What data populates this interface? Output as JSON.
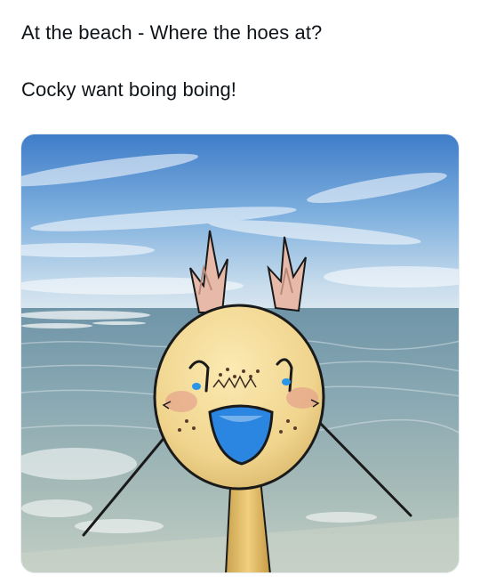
{
  "post": {
    "line1": "At the beach - Where the hoes at?",
    "line2": "Cocky want boing boing!"
  },
  "media": {
    "icon": "beach-cartoon-photo",
    "colors": {
      "sky_top": "#4a86cf",
      "sky_horizon": "#cfe0ec",
      "sea": "#7fa6b4",
      "sea_shallow": "#a9c2c2",
      "character_head": "#f3dd9a",
      "character_mouth": "#2a86e0"
    }
  }
}
